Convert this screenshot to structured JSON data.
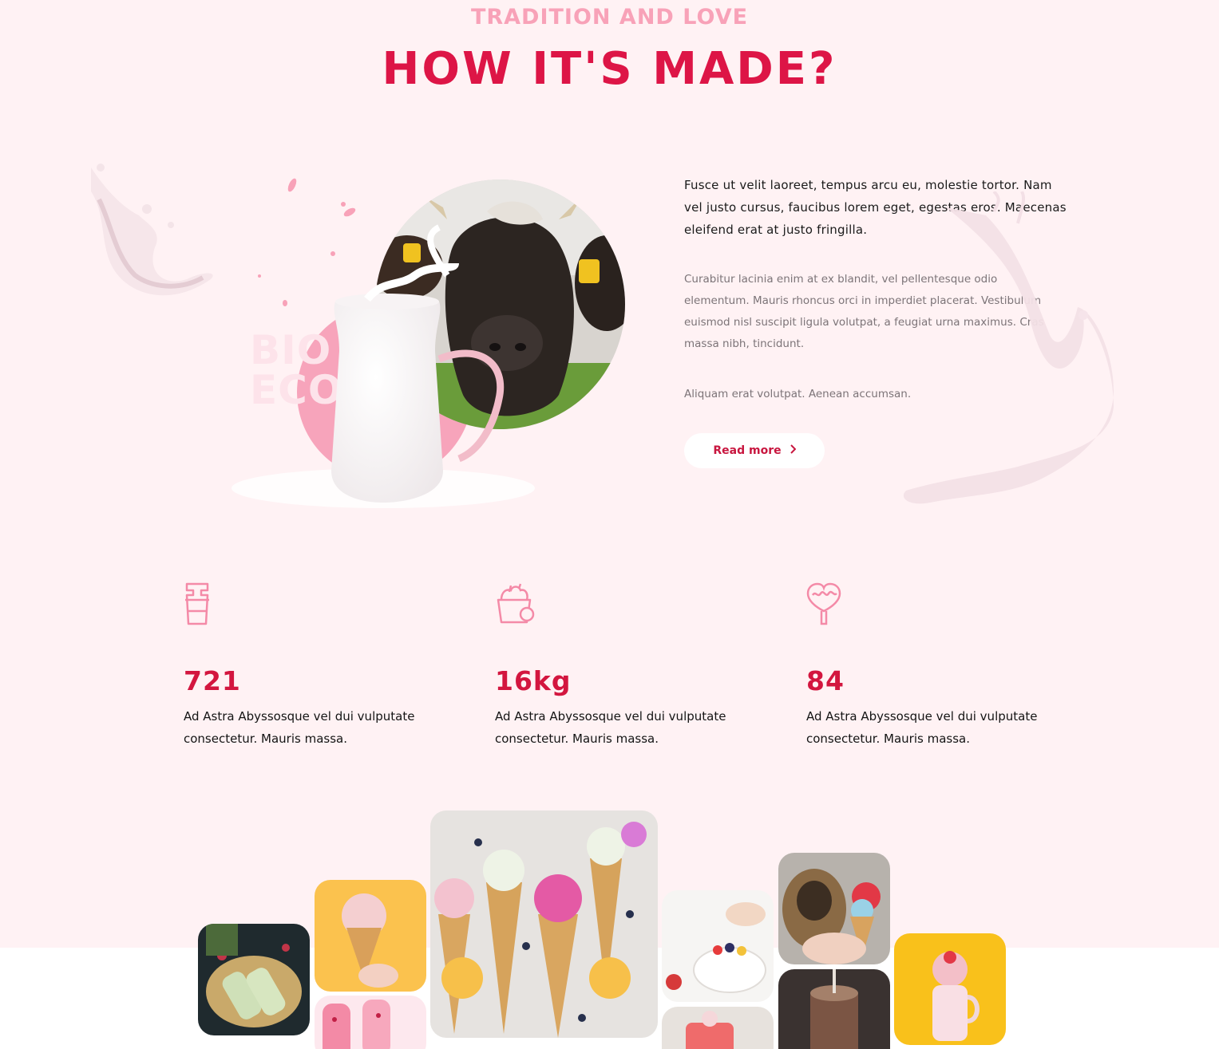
{
  "section": {
    "eyebrow": "TRADITION AND LOVE",
    "title": "HOW IT'S MADE?"
  },
  "illustration": {
    "badge_line1": "BIO",
    "badge_line2": "ECO"
  },
  "content": {
    "lead": "Fusce ut velit laoreet, tempus arcu eu, molestie tortor. Nam vel justo cursus, faucibus lorem eget, egestas eros. Maecenas eleifend erat at justo fringilla.",
    "paragraph1": "Curabitur lacinia enim at ex blandit, vel pellentesque odio elementum. Mauris rhoncus orci in imperdiet placerat. Vestibulum euismod nisl suscipit ligula volutpat, a feugiat urna maximus. Cras massa nibh, tincidunt.",
    "paragraph2": "Aliquam erat volutpat. Aenean accumsan.",
    "read_more_label": "Read more"
  },
  "stats": [
    {
      "icon": "milk-bucket-icon",
      "value": "721",
      "description": "Ad Astra Abyssosque vel dui vulputate consectetur. Mauris massa."
    },
    {
      "icon": "fruit-basket-icon",
      "value": "16kg",
      "description": "Ad Astra Abyssosque vel dui vulputate consectetur. Mauris massa."
    },
    {
      "icon": "heart-lollipop-icon",
      "value": "84",
      "description": "Ad Astra Abyssosque vel dui vulputate consectetur. Mauris massa."
    }
  ],
  "colors": {
    "background": "#fff2f4",
    "accent": "#dd1546",
    "eyebrow": "#f8a2b8",
    "icon": "#f48aa7"
  }
}
